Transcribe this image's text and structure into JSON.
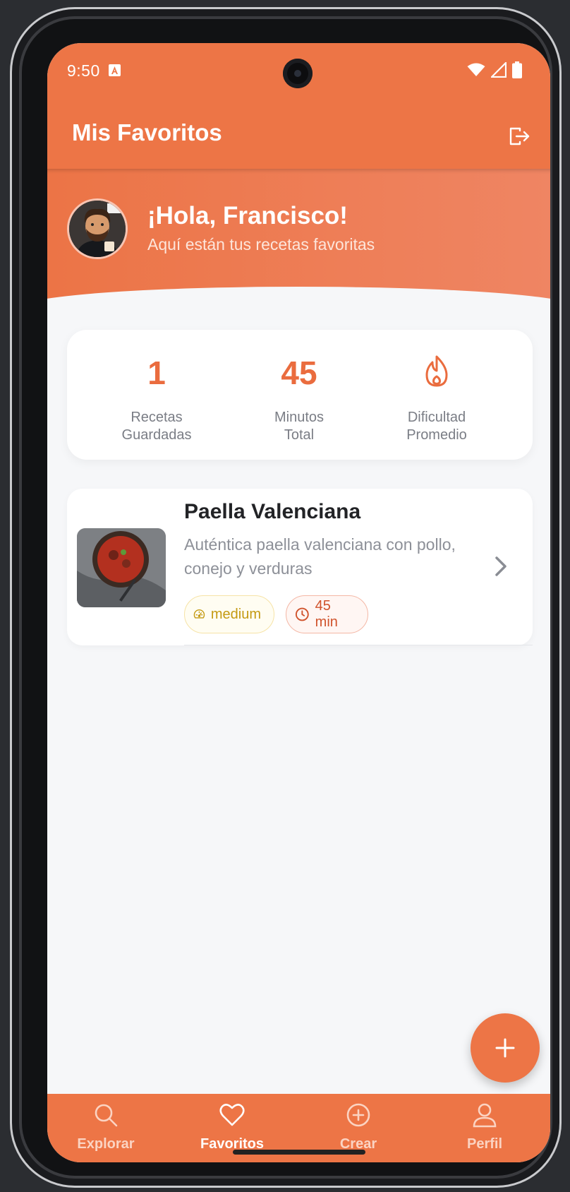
{
  "status_bar": {
    "time": "9:50"
  },
  "app_bar": {
    "title": "Mis Favoritos",
    "logout_icon": "logout-icon"
  },
  "greeting": {
    "title": "¡Hola, Francisco!",
    "subtitle": "Aquí están tus recetas favoritas"
  },
  "stats": [
    {
      "value": "1",
      "label_line1": "Recetas",
      "label_line2": "Guardadas"
    },
    {
      "value": "45",
      "label_line1": "Minutos",
      "label_line2": "Total"
    },
    {
      "icon": "flame-icon",
      "label_line1": "Dificultad",
      "label_line2": "Promedio"
    }
  ],
  "recipes": [
    {
      "title": "Paella Valenciana",
      "description": "Auténtica paella valenciana con pollo, conejo y verduras",
      "difficulty": "medium",
      "time": "45 min"
    }
  ],
  "nav": [
    {
      "label": "Explorar",
      "icon": "search-icon",
      "active": false
    },
    {
      "label": "Favoritos",
      "icon": "heart-icon",
      "active": true
    },
    {
      "label": "Crear",
      "icon": "plus-circle-icon",
      "active": false
    },
    {
      "label": "Perfil",
      "icon": "user-icon",
      "active": false
    }
  ],
  "colors": {
    "accent": "#ed7546",
    "difficulty": "#c49a12",
    "time": "#d0532c"
  }
}
